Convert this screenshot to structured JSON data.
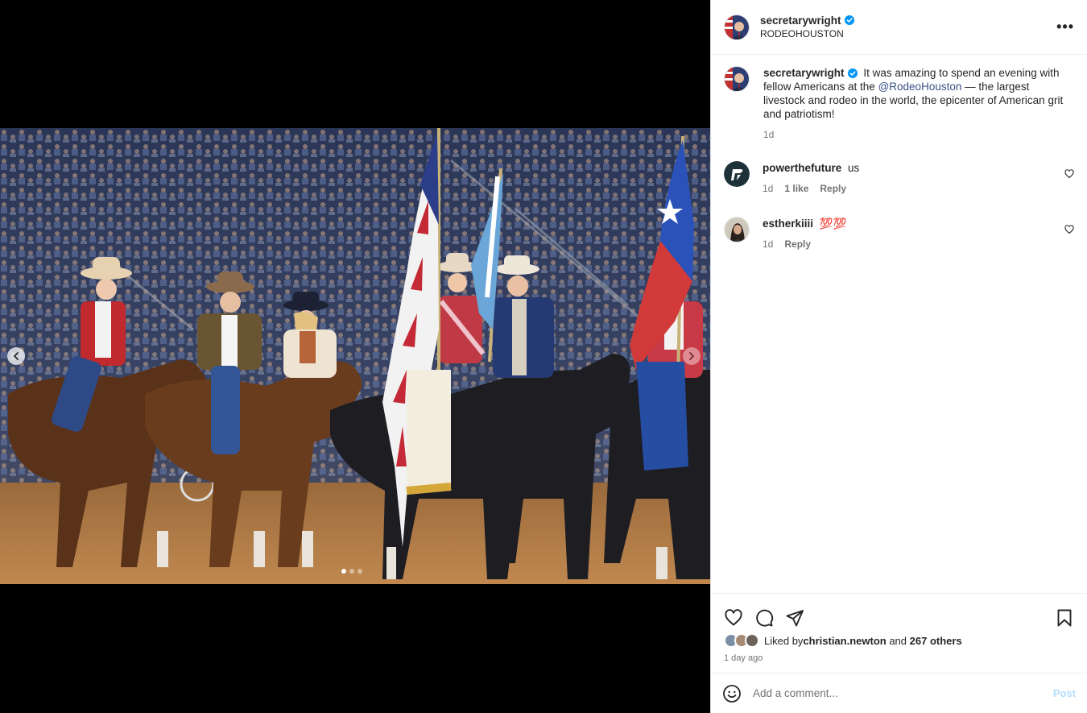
{
  "post": {
    "author": "secretarywright",
    "location": "RODEOHOUSTON",
    "caption_prefix": "It was amazing to spend an evening with fellow Americans at the ",
    "caption_mention": "@RodeoHouston",
    "caption_suffix": " — the largest livestock and rodeo in the world, the epicenter of American grit and patriotism!",
    "caption_time": "1d",
    "more_label": "•••"
  },
  "comments": [
    {
      "user": "powerthefuture",
      "text": "us",
      "time": "1d",
      "likes": "1 like",
      "reply": "Reply"
    },
    {
      "user": "estherkiiii",
      "text": "💯💯",
      "time": "1d",
      "reply": "Reply"
    }
  ],
  "likes": {
    "prefix": "Liked by ",
    "user": "christian.newton",
    "middle": " and ",
    "others": "267 others",
    "time_ago": "1 day ago"
  },
  "composer": {
    "placeholder": "Add a comment...",
    "post_label": "Post"
  },
  "carousel": {
    "index": 1,
    "count": 3
  },
  "colors": {
    "verified": "#0095f6",
    "mention": "#385185",
    "post_disabled": "#b2dffc"
  },
  "icons": [
    "chevron-left-icon",
    "chevron-right-icon",
    "heart-icon",
    "comment-icon",
    "share-icon",
    "bookmark-icon",
    "emoji-icon",
    "verified-icon"
  ]
}
